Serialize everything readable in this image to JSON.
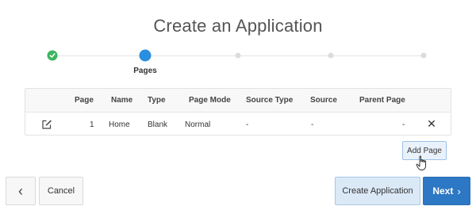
{
  "title": "Create an Application",
  "progress": {
    "current_label": "Pages"
  },
  "table": {
    "headers": {
      "page": "Page",
      "name": "Name",
      "type": "Type",
      "page_mode": "Page Mode",
      "source_type": "Source Type",
      "source": "Source",
      "parent_page": "Parent Page"
    },
    "rows": [
      {
        "page": "1",
        "name": "Home",
        "type": "Blank",
        "page_mode": "Normal",
        "source_type": "-",
        "source": "-",
        "parent_page": "-",
        "remove_glyph": "✕"
      }
    ]
  },
  "buttons": {
    "add_page": "Add Page",
    "back_glyph": "‹",
    "cancel": "Cancel",
    "create_application": "Create Application",
    "next": "Next",
    "next_glyph": "›"
  },
  "colors": {
    "step_done": "#3cb55f",
    "step_current": "#2a8fe0",
    "primary": "#2d78c4",
    "secondary_hot": "#dbe9f7"
  },
  "icons": {
    "row_edit": "edit-icon",
    "row_remove": "close-icon",
    "back": "chevron-left-icon",
    "next": "chevron-right-icon",
    "step_done": "check-icon"
  }
}
